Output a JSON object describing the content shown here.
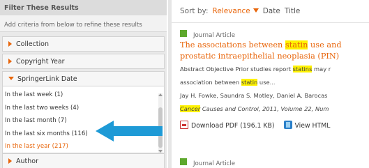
{
  "filter": {
    "header": "Filter These Results",
    "hint": "Add criteria from below to refine these results",
    "facets": {
      "collection": "Collection",
      "copyright": "Copyright Year",
      "springerlink_date": "SpringerLink Date",
      "author": "Author"
    },
    "date_options": [
      "In the last week (1)",
      "In the last two weeks (4)",
      "In the last month (7)",
      "In the last six months (116)",
      "In the last year (217)"
    ],
    "selected_date_option": "In the last year (217)"
  },
  "sort": {
    "label": "Sort by:",
    "relevance": "Relevance",
    "date": "Date",
    "title": "Title"
  },
  "results": [
    {
      "content_type": "Journal Article",
      "title_parts": [
        "The associations between ",
        "statin",
        " use and"
      ],
      "title_line2": "prostatic intraepithelial neoplasia (PIN)",
      "abstract_parts": [
        "Abstract Objective  Prior studies report ",
        "statins",
        " may r"
      ],
      "abstract_line2_parts": [
        "association between ",
        "statin",
        " use..."
      ],
      "authors": "Jay H. Fowke, Saundra S. Motley, Daniel A. Barocas",
      "journal_name": "Cancer",
      "journal_rest": " Causes and Control, 2011, Volume 22, Num",
      "download_pdf": "Download PDF (196.1 KB)",
      "view_html": "View HTML"
    },
    {
      "content_type": "Journal Article"
    }
  ],
  "colors": {
    "accent_orange": "#e8650a",
    "arrow_blue": "#1e9ad6",
    "article_green": "#5ea82d",
    "highlight_yellow": "#fff200"
  }
}
